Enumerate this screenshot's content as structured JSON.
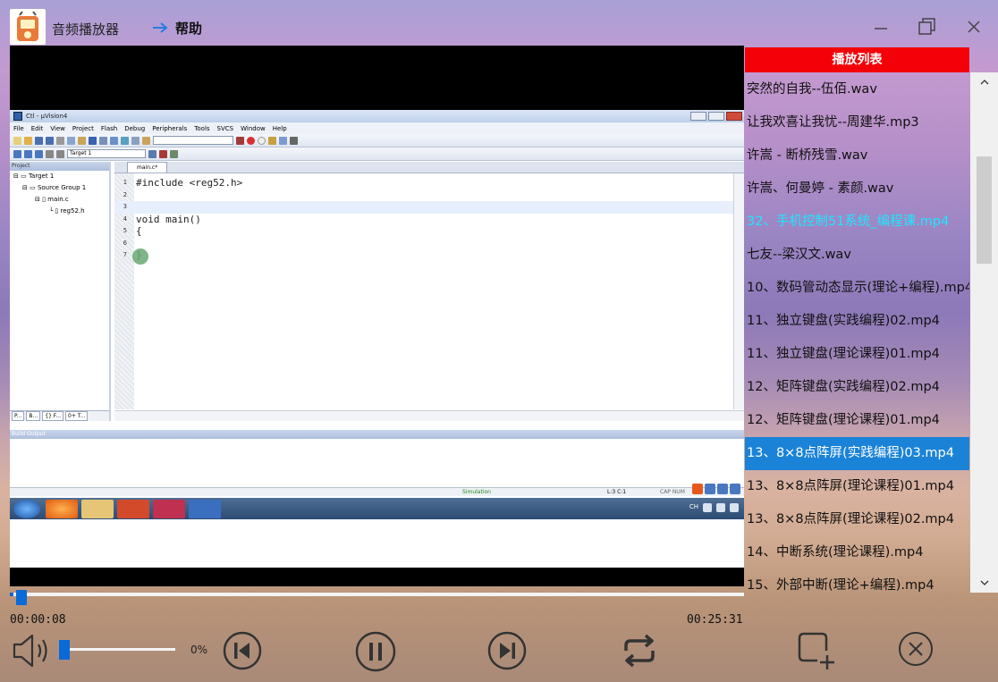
{
  "app": {
    "title": "音频播放器",
    "help_label": "帮助"
  },
  "video_frame": {
    "window_title": "Ctl - µVision4",
    "menus": [
      "File",
      "Edit",
      "View",
      "Project",
      "Flash",
      "Debug",
      "Peripherals",
      "Tools",
      "SVCS",
      "Window",
      "Help"
    ],
    "target_label": "Target 1",
    "project_panel_title": "Project",
    "tree": [
      "Target 1",
      "Source Group 1",
      "main.c",
      "reg52.h"
    ],
    "panel_tabs": [
      "P...",
      "B...",
      "{} F...",
      "0+ T..."
    ],
    "editor_tab": "main.c*",
    "code_lines": [
      {
        "n": "1",
        "text": "#include <reg52.h>"
      },
      {
        "n": "2",
        "text": ""
      },
      {
        "n": "3",
        "text": ""
      },
      {
        "n": "4",
        "text": "void main()"
      },
      {
        "n": "5",
        "text": "{"
      },
      {
        "n": "6",
        "text": ""
      },
      {
        "n": "7",
        "text": "}"
      }
    ],
    "build_output_title": "Build Output",
    "status_simulation": "Simulation",
    "status_position": "L:3 C:1",
    "status_caps": "CAP  NUM",
    "tray_lang": "CH"
  },
  "playlist": {
    "title": "播放列表",
    "playing_index": 4,
    "selected_index": 11,
    "items": [
      "突然的自我--伍佰.wav",
      "让我欢喜让我忧--周建华.mp3",
      "许嵩 - 断桥残雪.wav",
      "许嵩、何曼婷 - 素颜.wav",
      "32、手机控制51系统_编程课.mp4",
      "七友--梁汉文.wav",
      "10、数码管动态显示(理论+编程).mp4",
      "11、独立键盘(实践编程)02.mp4",
      "11、独立键盘(理论课程)01.mp4",
      "12、矩阵键盘(实践编程)02.mp4",
      "12、矩阵键盘(理论课程)01.mp4",
      "13、8×8点阵屏(实践编程)03.mp4",
      "13、8×8点阵屏(理论课程)01.mp4",
      "13、8×8点阵屏(理论课程)02.mp4",
      "14、中断系统(理论课程).mp4",
      "15、外部中断(理论+编程).mp4"
    ]
  },
  "player": {
    "progress_fraction": 0.0053,
    "time_current": "00:00:08",
    "time_total": "00:25:31",
    "volume_fraction": 0.0,
    "volume_percent": "0%"
  },
  "icons": {
    "volume": "speaker-icon",
    "prev": "skip-previous-icon",
    "pause": "pause-icon",
    "next": "skip-next-icon",
    "repeat": "repeat-icon",
    "add": "add-to-playlist-icon",
    "clear": "clear-icon"
  },
  "colors": {
    "playlist_header": "#f40008",
    "selected_row": "#1a83d8",
    "playing_text": "#1ee6ff",
    "accent": "#0a6ad8"
  }
}
